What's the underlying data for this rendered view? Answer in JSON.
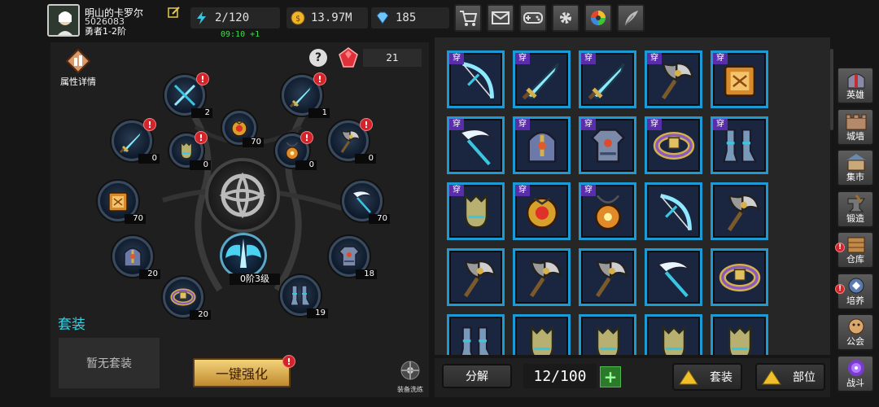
{
  "player": {
    "name": "明山的卡罗尔",
    "id": "5026083",
    "rank": "勇者1-2阶"
  },
  "resources": {
    "stamina": "2/120",
    "gold": "13.97M",
    "diamonds": "185",
    "timer": "09:10 +1"
  },
  "equip_panel": {
    "attr_label": "属性详情",
    "help": "?",
    "gem_count": "21",
    "slots": [
      {
        "count": "2",
        "alert": true,
        "icon": "dual-blade-icon"
      },
      {
        "count": "1",
        "alert": true,
        "icon": "sword-icon"
      },
      {
        "count": "70",
        "alert": false,
        "icon": "amulet-icon"
      },
      {
        "count": "0",
        "alert": true,
        "icon": "sword-icon"
      },
      {
        "count": "0",
        "alert": true,
        "icon": "glove-icon"
      },
      {
        "count": "0",
        "alert": true,
        "icon": "necklace-icon"
      },
      {
        "count": "0",
        "alert": true,
        "icon": "axe-icon"
      },
      {
        "count": "70",
        "alert": false,
        "icon": "book-icon"
      },
      {
        "count": "70",
        "alert": false,
        "icon": "scythe-icon"
      },
      {
        "count": "20",
        "alert": false,
        "icon": "helmet-icon"
      },
      {
        "count": "18",
        "alert": false,
        "icon": "armor-icon"
      },
      {
        "count": "20",
        "alert": false,
        "icon": "belt-icon"
      },
      {
        "count": "19",
        "alert": false,
        "icon": "boots-icon"
      }
    ],
    "weapon_level": "0阶3级",
    "suit_title": "套装",
    "suit_empty": "暂无套装",
    "upgrade_button": "一键强化",
    "wash_label": "装备洗练"
  },
  "inventory": {
    "wear_tag": "穿",
    "items": [
      {
        "icon": "bow-icon",
        "worn": true
      },
      {
        "icon": "sword-icon",
        "worn": true
      },
      {
        "icon": "sword-icon",
        "worn": true
      },
      {
        "icon": "axe-icon",
        "worn": true
      },
      {
        "icon": "book-icon",
        "worn": true
      },
      {
        "icon": "scythe-icon",
        "worn": true
      },
      {
        "icon": "helmet-icon",
        "worn": true
      },
      {
        "icon": "armor-icon",
        "worn": true
      },
      {
        "icon": "belt-icon",
        "worn": true
      },
      {
        "icon": "boots-icon",
        "worn": true
      },
      {
        "icon": "glove-icon",
        "worn": true
      },
      {
        "icon": "amulet-icon",
        "worn": true
      },
      {
        "icon": "necklace-icon",
        "worn": true
      },
      {
        "icon": "bow-icon",
        "worn": false
      },
      {
        "icon": "axe-icon",
        "worn": false
      },
      {
        "icon": "axe-icon",
        "worn": false
      },
      {
        "icon": "axe-icon",
        "worn": false
      },
      {
        "icon": "axe-icon",
        "worn": false
      },
      {
        "icon": "scythe-icon",
        "worn": false
      },
      {
        "icon": "belt-icon",
        "worn": false
      },
      {
        "icon": "boots-icon",
        "worn": false
      },
      {
        "icon": "glove-icon",
        "worn": false
      },
      {
        "icon": "glove-icon",
        "worn": false
      },
      {
        "icon": "glove-icon",
        "worn": false
      },
      {
        "icon": "glove-icon",
        "worn": false
      }
    ],
    "decompose": "分解",
    "capacity": "12/100",
    "add": "+",
    "sort_suit": "套装",
    "sort_part": "部位"
  },
  "side_nav": [
    {
      "label": "英雄",
      "icon": "helmet-icon",
      "alert": false
    },
    {
      "label": "城墙",
      "icon": "wall-icon",
      "alert": false
    },
    {
      "label": "集市",
      "icon": "market-icon",
      "alert": false
    },
    {
      "label": "锻造",
      "icon": "anvil-icon",
      "alert": false
    },
    {
      "label": "仓库",
      "icon": "warehouse-icon",
      "alert": true
    },
    {
      "label": "培养",
      "icon": "train-icon",
      "alert": true
    },
    {
      "label": "公会",
      "icon": "guild-icon",
      "alert": false
    },
    {
      "label": "战斗",
      "icon": "portal-icon",
      "alert": false
    }
  ],
  "colors": {
    "accent": "#36d3e8",
    "frame": "#1c9ad6",
    "alert": "#d3242b",
    "wear_tag": "#5a2eaa"
  }
}
